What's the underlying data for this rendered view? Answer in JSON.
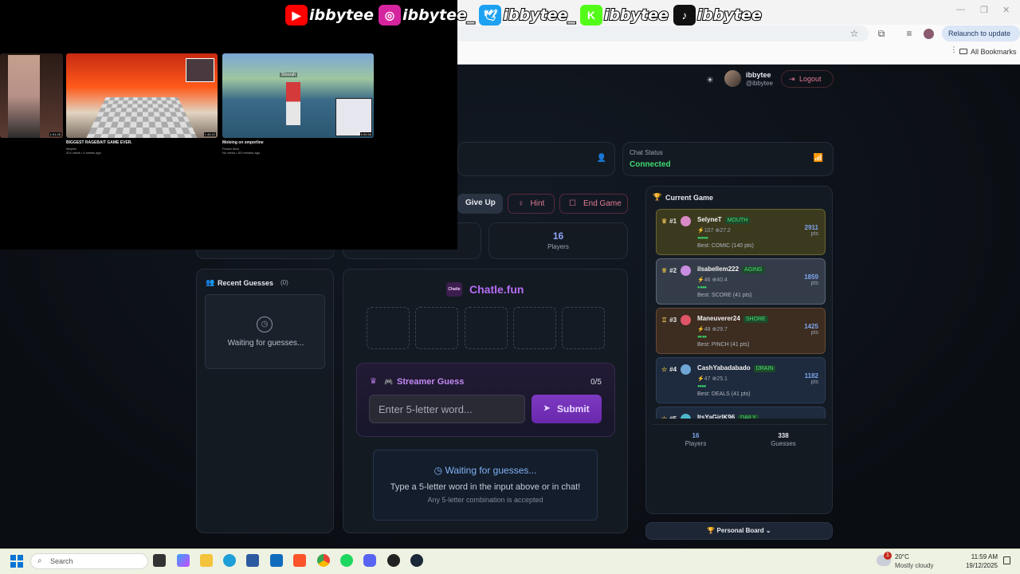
{
  "overlay": {
    "socials": [
      {
        "icon": "youtube-icon",
        "handle": "ibbytee",
        "color": "#ff0000",
        "glyph": "▶"
      },
      {
        "icon": "instagram-icon",
        "handle": "ibbytee_",
        "color": "#d6249f",
        "glyph": "◎"
      },
      {
        "icon": "twitter-icon",
        "handle": "ibbytee_",
        "color": "#1da1f2",
        "glyph": "🕊"
      },
      {
        "icon": "kick-icon",
        "handle": "ibbytee",
        "color": "#53fc18",
        "glyph": "K"
      },
      {
        "icon": "tiktok-icon",
        "handle": "ibbytee",
        "color": "#111111",
        "glyph": "♪"
      }
    ],
    "videos": [
      {
        "title": "",
        "meta": "",
        "duration": "1:01:25",
        "partial": true
      },
      {
        "title": "BIGGEST RAGEBAIT GAME EVER.",
        "channel": "ibbytee",
        "meta": "324 views • 4 weeks ago",
        "duration": "1:40:22"
      },
      {
        "title": "Moleing on smporline",
        "channel": "Flower 8am",
        "meta": "No views • 50 minutes ago",
        "duration": "5:55:58",
        "overlay_text": "Stozzah"
      }
    ]
  },
  "browser": {
    "relaunch_label": "Relaunch to update",
    "bookmarks_label": "All Bookmarks"
  },
  "header": {
    "username": "ibbytee",
    "handle": "@ibbytee",
    "logout_label": "Logout"
  },
  "status": {
    "chat_status_label": "Chat Status",
    "chat_status_value": "Connected"
  },
  "controls": {
    "give_up": "Give Up",
    "hint": "Hint",
    "end_game": "End Game"
  },
  "stats": {
    "players_value": "16",
    "players_label": "Players"
  },
  "recent_guesses": {
    "title": "Recent Guesses",
    "count": "(0)",
    "waiting": "Waiting for guesses..."
  },
  "game": {
    "logo_text": "Chatle",
    "title": "Chatle.fun",
    "streamer_guess_title": "Streamer Guess",
    "guess_count": "0/5",
    "input_placeholder": "Enter 5-letter word...",
    "submit_label": "Submit",
    "waiting_title": "Waiting for guesses...",
    "waiting_line1": "Type a 5-letter word in the input above or in chat!",
    "waiting_line2": "Any 5-letter combination is accepted"
  },
  "leaderboard": {
    "title": "Current Game",
    "entries": [
      {
        "rank": "#1",
        "name": "SelyneT",
        "word": "MOUTH",
        "sub": "⚡107 ⊕27.2",
        "dots": "●●●●●",
        "best": "Best: COMIC (140 pts)",
        "points": "2911",
        "bg": "#3c3a1e",
        "border": "#6a6531",
        "avatar": "#d989c6"
      },
      {
        "rank": "#2",
        "name": "ilsabellem222",
        "word": "AGING",
        "sub": "⚡46 ⊕40.4",
        "dots": "● ●●●",
        "best": "Best: SCORE (41 pts)",
        "points": "1859",
        "bg": "#343c49",
        "border": "#5b6678",
        "avatar": "#c98de0"
      },
      {
        "rank": "#3",
        "name": "Maneuverer24",
        "word": "SHORE",
        "sub": "⚡48 ⊕29.7",
        "dots": "●● ●●",
        "best": "Best: PINCH (41 pts)",
        "points": "1425",
        "bg": "#3d2c20",
        "border": "#674a34",
        "avatar": "#e05468"
      },
      {
        "rank": "#4",
        "name": "CashYabadabado",
        "word": "DRAIN",
        "sub": "⚡47 ⊕25.1",
        "dots": "●●●●",
        "best": "Best: DEALS (41 pts)",
        "points": "1182",
        "bg": "#1e2a3d",
        "border": "#2d3e58",
        "avatar": "#6fa6d6"
      },
      {
        "rank": "#5",
        "name": "ItsYaGirlK96",
        "word": "DAILY",
        "sub": "",
        "dots": "",
        "best": "",
        "points": "",
        "bg": "#1e2a3d",
        "border": "#2d3e58",
        "avatar": "#4fb6c9"
      }
    ],
    "players_value": "16",
    "players_label": "Players",
    "guesses_value": "338",
    "guesses_label": "Guesses",
    "pts_label": "pts",
    "personal_board": "Personal Board"
  },
  "taskbar": {
    "search_label": "Search",
    "weather_temp": "20°C",
    "weather_desc": "Mostly cloudy",
    "time": "11:59 AM",
    "date": "19/12/2025",
    "weather_badge": "1"
  }
}
